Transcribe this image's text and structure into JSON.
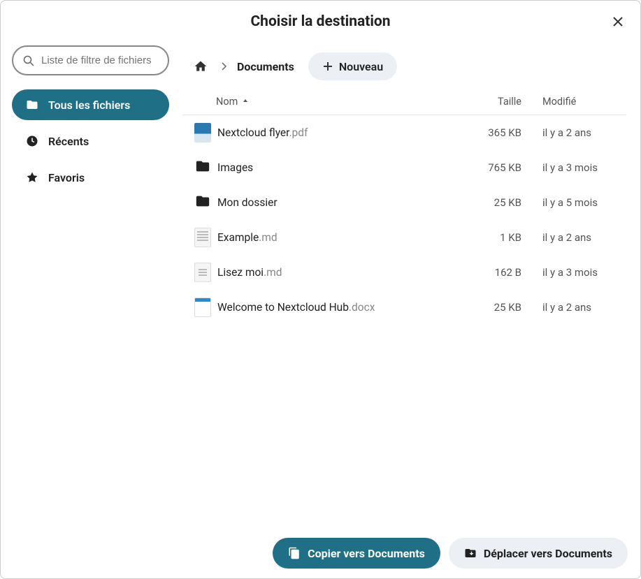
{
  "dialog": {
    "title": "Choisir la destination"
  },
  "search": {
    "placeholder": "Liste de filtre de fichiers"
  },
  "sidebar": {
    "items": [
      {
        "label": "Tous les fichiers",
        "icon": "folder-icon",
        "active": true
      },
      {
        "label": "Récents",
        "icon": "clock-icon",
        "active": false
      },
      {
        "label": "Favoris",
        "icon": "star-icon",
        "active": false
      }
    ]
  },
  "breadcrumb": {
    "current": "Documents",
    "new_label": "Nouveau"
  },
  "columns": {
    "name": "Nom",
    "size": "Taille",
    "modified": "Modifié"
  },
  "files": [
    {
      "name": "Nextcloud flyer",
      "ext": ".pdf",
      "type": "pdf",
      "size": "365 KB",
      "modified": "il y a 2 ans"
    },
    {
      "name": "Images",
      "ext": "",
      "type": "folder",
      "size": "765 KB",
      "modified": "il y a 3 mois"
    },
    {
      "name": "Mon dossier",
      "ext": "",
      "type": "folder",
      "size": "25 KB",
      "modified": "il y a 5 mois"
    },
    {
      "name": "Example",
      "ext": ".md",
      "type": "doc",
      "size": "1 KB",
      "modified": "il y a 2 ans"
    },
    {
      "name": "Lisez moi",
      "ext": ".md",
      "type": "doc-narrow",
      "size": "162 B",
      "modified": "il y a 3 mois"
    },
    {
      "name": "Welcome to Nextcloud Hub",
      "ext": ".docx",
      "type": "docx",
      "size": "25 KB",
      "modified": "il y a 2 ans"
    }
  ],
  "footer": {
    "copy_label": "Copier vers Documents",
    "move_label": "Déplacer vers Documents"
  }
}
